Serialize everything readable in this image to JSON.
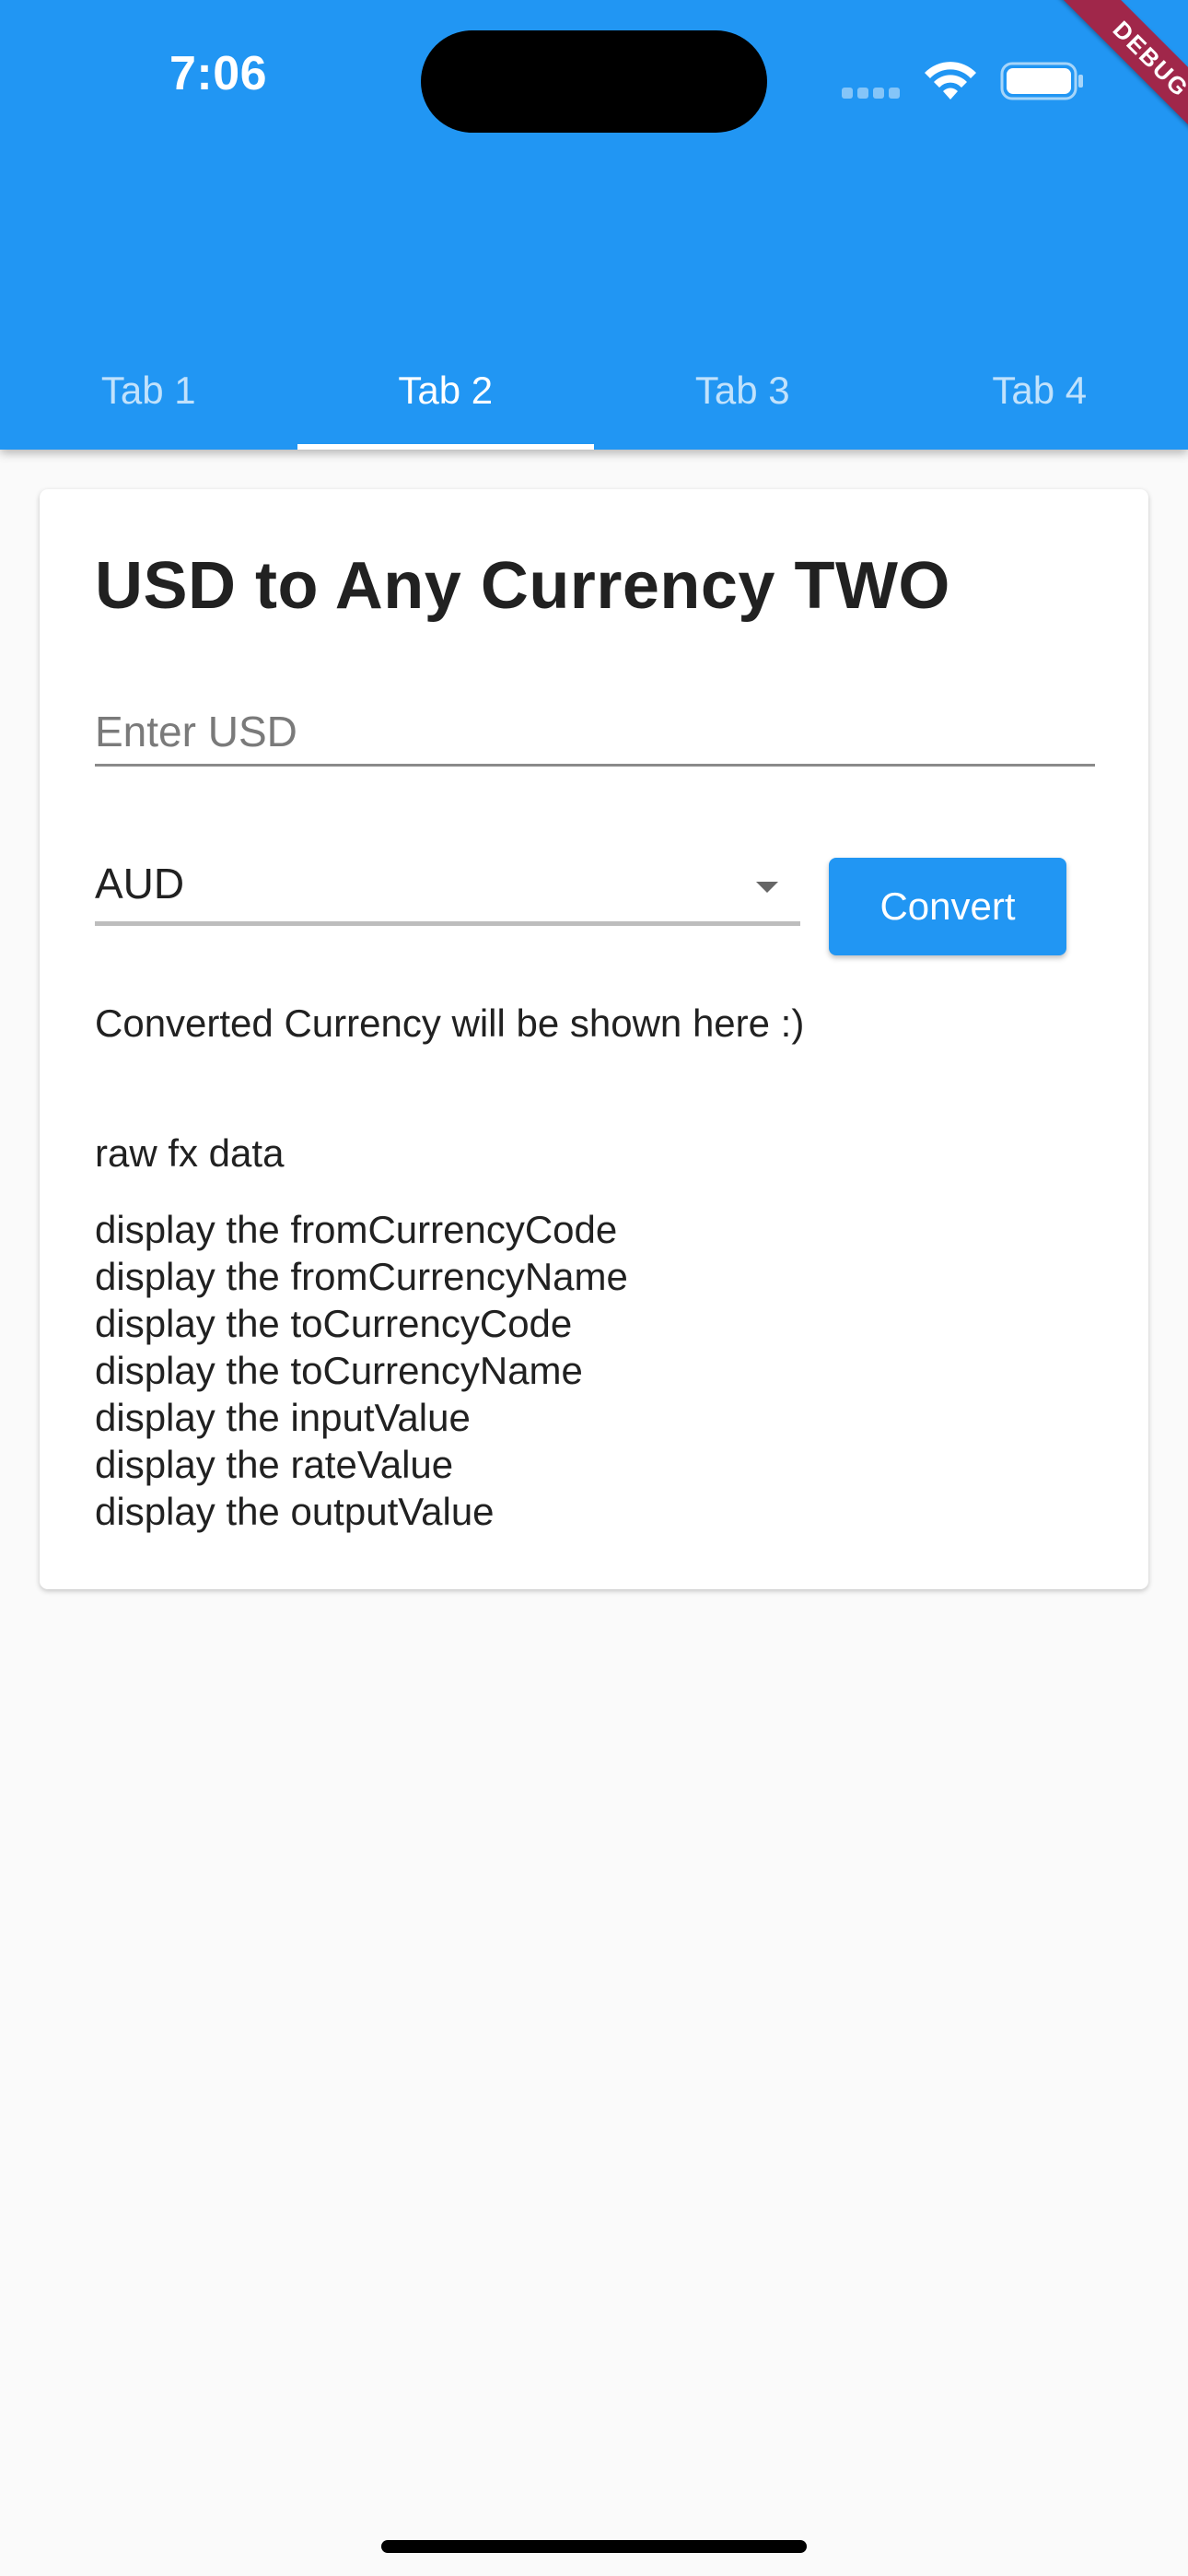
{
  "status_bar": {
    "time": "7:06"
  },
  "debug_banner": "DEBUG",
  "tabs": [
    {
      "label": "Tab 1",
      "active": false
    },
    {
      "label": "Tab 2",
      "active": true
    },
    {
      "label": "Tab 3",
      "active": false
    },
    {
      "label": "Tab 4",
      "active": false
    }
  ],
  "card": {
    "title": "USD to Any Currency TWO",
    "usd_input": {
      "placeholder": "Enter USD",
      "value": ""
    },
    "currency_select": {
      "selected": "AUD"
    },
    "convert_label": "Convert",
    "converted_text": "Converted Currency will be shown here :)",
    "raw_label": "raw fx data",
    "raw_lines": [
      "display the fromCurrencyCode",
      "display the fromCurrencyName",
      "display the toCurrencyCode",
      "display the toCurrencyName",
      "display the inputValue",
      "display the rateValue",
      "display the outputValue"
    ]
  },
  "colors": {
    "primary": "#2196f3",
    "background": "#fafafa",
    "card": "#ffffff",
    "debug_ribbon": "#a0274a"
  },
  "icons": [
    "cellular-signal-icon",
    "wifi-icon",
    "battery-icon",
    "dropdown-arrow-icon"
  ]
}
